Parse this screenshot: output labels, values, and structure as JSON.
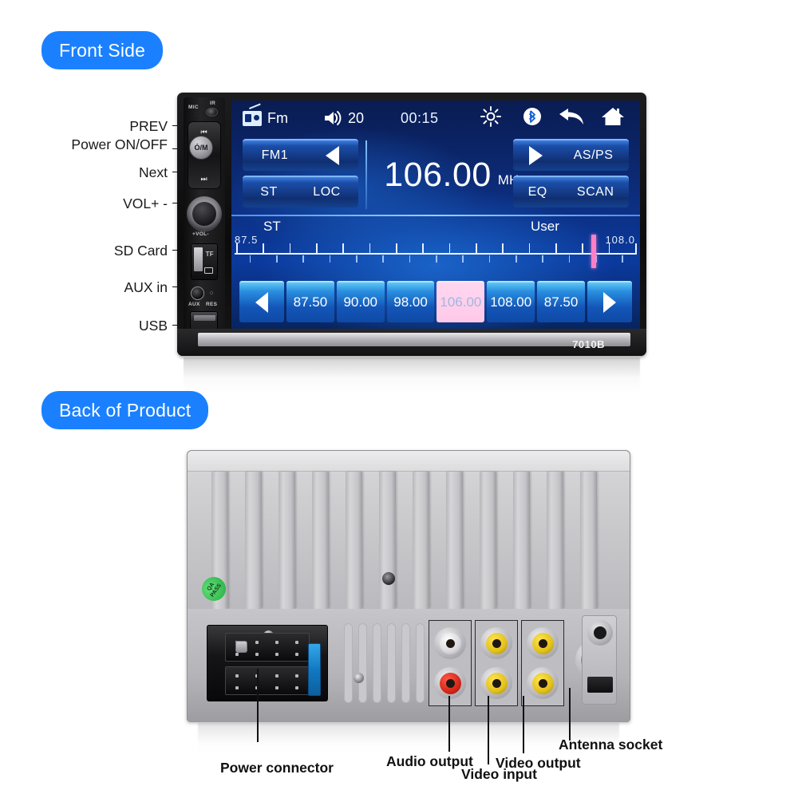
{
  "sections": {
    "front_badge": "Front Side",
    "back_badge": "Back of Product"
  },
  "front_annotations": [
    {
      "label": "PREV"
    },
    {
      "label": "Power ON/OFF"
    },
    {
      "label": "Next"
    },
    {
      "label": "VOL+ -"
    },
    {
      "label": "SD Card"
    },
    {
      "label": "AUX in"
    },
    {
      "label": "USB"
    }
  ],
  "device": {
    "model": "7010B",
    "front_panel": {
      "mic_label": "MIC",
      "ir_label": "IR",
      "prev_glyph": "⏮",
      "power_label": "Ó/M",
      "next_glyph": "⏭",
      "vol_label": "+VOL-",
      "tf_label": "TF",
      "aux_label": "AUX",
      "res_label": "RES"
    }
  },
  "screen": {
    "status_bar": {
      "source_icon": "radio-icon",
      "source_label": "Fm",
      "volume_icon": "speaker-icon",
      "volume_value": "20",
      "clock": "00:15",
      "brightness_icon": "sun-icon",
      "bluetooth_icon": "bluetooth-icon",
      "back_icon": "back-arrow-icon",
      "home_icon": "home-icon"
    },
    "controls": {
      "band_label": "FM1",
      "prev_icon": "triangle-left-icon",
      "st_label": "ST",
      "loc_label": "LOC",
      "next_icon": "triangle-right-icon",
      "asps_label": "AS/PS",
      "eq_label": "EQ",
      "scan_label": "SCAN"
    },
    "frequency": {
      "value": "106.00",
      "unit": "MHz"
    },
    "tuning": {
      "stereo_label": "ST",
      "user_label": "User",
      "scale_min": "87.5",
      "scale_max": "108.0",
      "marker_position_percent": 89
    },
    "presets": {
      "prev_icon": "chevron-left-icon",
      "next_icon": "chevron-right-icon",
      "items": [
        {
          "value": "87.50",
          "active": false
        },
        {
          "value": "90.00",
          "active": false
        },
        {
          "value": "98.00",
          "active": false
        },
        {
          "value": "106.00",
          "active": true
        },
        {
          "value": "108.00",
          "active": false
        },
        {
          "value": "87.50",
          "active": false
        }
      ]
    }
  },
  "back": {
    "qa_sticker": "QA PASS",
    "annotations": [
      {
        "label": "Power connector"
      },
      {
        "label": "Audio output"
      },
      {
        "label": "Video input"
      },
      {
        "label": "Video output"
      },
      {
        "label": "Antenna socket"
      }
    ]
  },
  "colors": {
    "accent_blue": "#1a80ff",
    "screen_blue": "#0c2a75",
    "preset_active": "#ffc9e9",
    "marker_pink": "#ff7fc6",
    "antenna_yellow": "#9a8f22"
  },
  "chart_data": null
}
